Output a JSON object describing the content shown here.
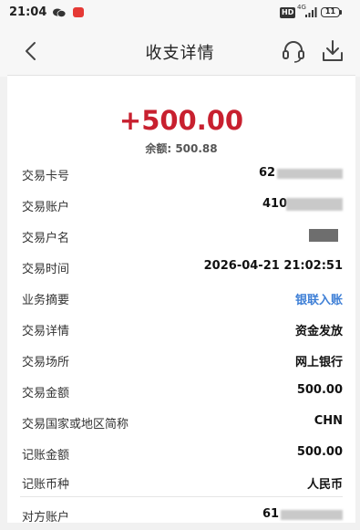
{
  "status_bar": {
    "time": "21:04",
    "network": "4G",
    "battery": "11"
  },
  "header": {
    "title": "收支详情"
  },
  "summary": {
    "amount": "+500.00",
    "balance": "余额: 500.88"
  },
  "rows": [
    {
      "label": "交易卡号",
      "value": "62"
    },
    {
      "label": "交易账户",
      "value": "410"
    },
    {
      "label": "交易户名",
      "value": ""
    },
    {
      "label": "交易时间",
      "value": "2026-04-21 21:02:51"
    },
    {
      "label": "业务摘要",
      "value": "银联入账"
    },
    {
      "label": "交易详情",
      "value": "资金发放"
    },
    {
      "label": "交易场所",
      "value": "网上银行"
    },
    {
      "label": "交易金额",
      "value": "500.00"
    },
    {
      "label": "交易国家或地区简称",
      "value": "CHN"
    },
    {
      "label": "记账金额",
      "value": "500.00"
    },
    {
      "label": "记账币种",
      "value": "人民币"
    },
    {
      "label": "对方账户",
      "value": "61"
    }
  ],
  "colors": {
    "amount": "#c8202f",
    "link": "#3e7fd6"
  }
}
